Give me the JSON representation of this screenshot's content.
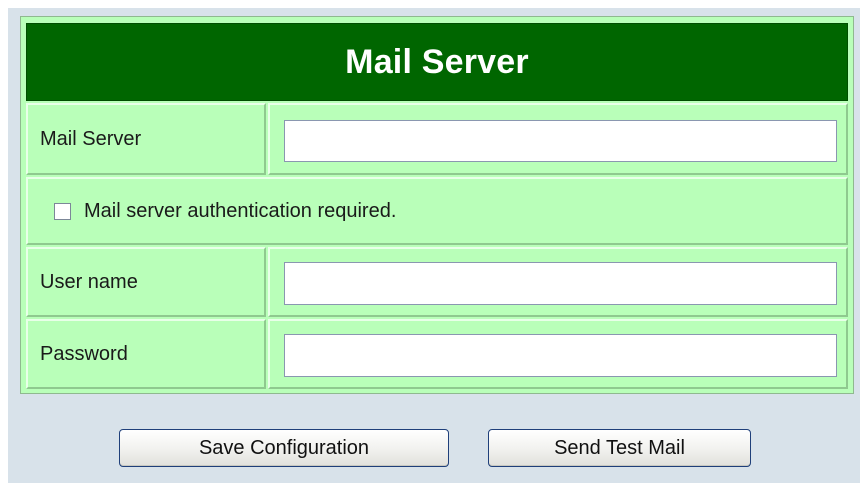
{
  "form": {
    "title": "Mail Server",
    "mail_server_label": "Mail Server",
    "mail_server_value": "",
    "auth_label": "Mail server authentication required.",
    "auth_checked": false,
    "user_name_label": "User name",
    "user_name_value": "",
    "password_label": "Password",
    "password_value": ""
  },
  "buttons": {
    "save_label": "Save Configuration",
    "test_label": "Send Test Mail"
  },
  "colors": {
    "header_bg": "#006600",
    "table_bg": "#b9ffb9",
    "page_bg": "#d8e2ea"
  }
}
